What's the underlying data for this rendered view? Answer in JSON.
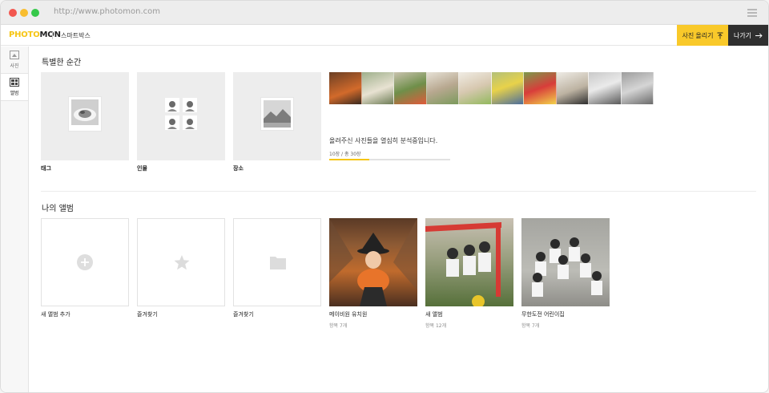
{
  "browser": {
    "url": "http://www.photomon.com"
  },
  "app": {
    "logo_part1": "PHOTO",
    "logo_part2": "MON",
    "title": "스마트박스",
    "upload_label": "사진 올리기",
    "upload_icon": "upload-icon",
    "logout_label": "나가기",
    "logout_icon": "arrow-right-icon",
    "accent_color": "#f9c92a"
  },
  "sidebar": {
    "items": [
      {
        "label": "사진",
        "icon": "photo-icon",
        "active": false
      },
      {
        "label": "앨범",
        "icon": "album-icon",
        "active": true
      }
    ]
  },
  "special": {
    "title": "특별한 순간",
    "cards": [
      {
        "label": "태그",
        "icon": "food-photo-icon"
      },
      {
        "label": "인물",
        "icon": "people-grid-icon"
      },
      {
        "label": "장소",
        "icon": "landscape-photo-icon"
      }
    ],
    "analysis_text": "올려주신 사진들을 열심히 분석중입니다.",
    "progress_label": "10장 / 총 30장",
    "progress_done": 10,
    "progress_total": 30
  },
  "albums": {
    "title": "나의 앨범",
    "items": [
      {
        "label": "새 앨범 추가",
        "sub": "",
        "kind": "add"
      },
      {
        "label": "즐겨찾기",
        "sub": "",
        "kind": "star"
      },
      {
        "label": "즐겨찾기",
        "sub": "",
        "kind": "folder"
      },
      {
        "label": "메이비원 유치원",
        "sub": "항목 7개",
        "kind": "photo"
      },
      {
        "label": "새 앨범",
        "sub": "항목 12개",
        "kind": "photo"
      },
      {
        "label": "무한도전 어린이집",
        "sub": "항목 7개",
        "kind": "photo"
      }
    ]
  }
}
